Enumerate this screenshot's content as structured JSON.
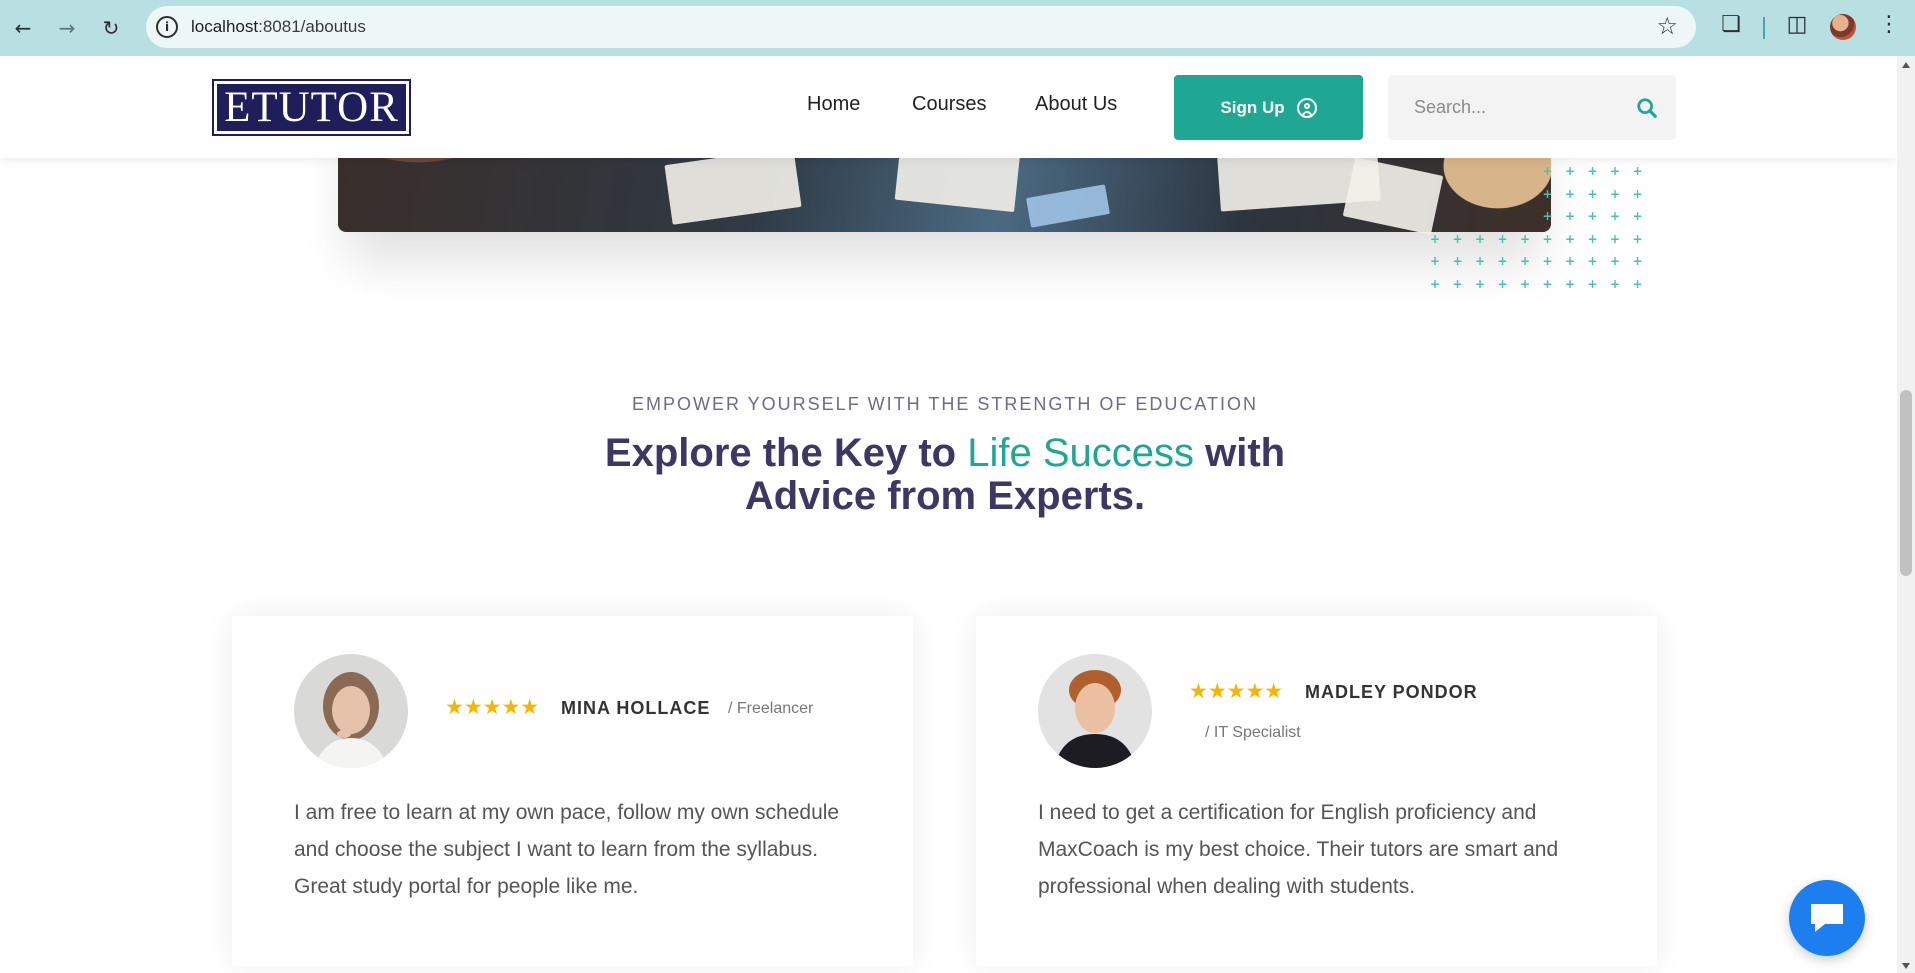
{
  "browser": {
    "url_host": "localhost",
    "url_path": ":8081/aboutus"
  },
  "header": {
    "logo_text": "ETUTOR",
    "nav": [
      "Home",
      "Courses",
      "About Us"
    ],
    "signup_label": "Sign Up",
    "search_placeholder": "Search..."
  },
  "section": {
    "eyebrow": "EMPOWER YOURSELF WITH THE STRENGTH OF EDUCATION",
    "heading_part1": "Explore the Key to ",
    "heading_accent": "Life Success",
    "heading_part2": " with Advice from Experts."
  },
  "testimonials": [
    {
      "stars": "★★★★★",
      "name": "MINA HOLLACE",
      "role": "/ Freelancer",
      "quote": "I am free to learn at my own pace, follow my own schedule and choose the subject I want to learn from the syllabus. Great study portal for people like me."
    },
    {
      "stars": "★★★★★",
      "name": "MADLEY PONDOR",
      "role": "/ IT Specialist",
      "quote": "I need to get a certification for English proficiency and MaxCoach is my best choice. Their tutors are smart and professional when dealing with students."
    }
  ],
  "colors": {
    "brand_navy": "#1f1d5a",
    "accent_teal": "#20a794",
    "heading_purple": "#3e3663",
    "star_gold": "#f6b500",
    "chat_blue": "#1d7ef0"
  },
  "icons": {
    "back": "arrow-left-icon",
    "forward": "arrow-right-icon",
    "reload": "reload-icon",
    "info": "info-icon",
    "bookmark": "star-icon",
    "extensions": "puzzle-icon",
    "side_panel": "side-panel-icon",
    "menu": "kebab-menu-icon",
    "signup": "user-circle-icon",
    "search": "search-icon",
    "chat": "chat-bubble-icon"
  }
}
